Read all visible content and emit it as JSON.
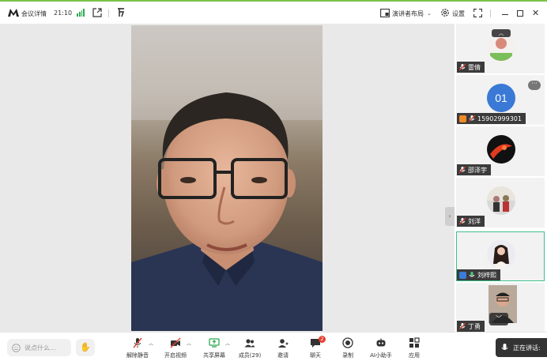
{
  "topbar": {
    "title": "会议详情",
    "time": "21:10",
    "layout_label": "演讲者布局",
    "settings_label": "设置"
  },
  "participants": [
    {
      "name": "雷倩",
      "avatar": "photo"
    },
    {
      "name": "15902999301",
      "avatar_text": "01",
      "host": true
    },
    {
      "name": "邵泽宇",
      "avatar": "photo"
    },
    {
      "name": "刘洋",
      "avatar": "photo"
    },
    {
      "name": "刘梓熙",
      "avatar": "photo",
      "active": true,
      "badge": "blue"
    },
    {
      "name": "丁勇",
      "avatar": "photo"
    }
  ],
  "toolbar": {
    "say_placeholder": "说点什么...",
    "unmute": "解除静音",
    "start_video": "开启视频",
    "share_screen": "共享屏幕",
    "members": "成员(29)",
    "invite": "邀请",
    "chat": "聊天",
    "chat_badge": "2",
    "record": "录制",
    "ai_assistant": "AI小助手",
    "apps": "应用",
    "speaking": "正在讲话:"
  },
  "colors": {
    "accent_green": "#7ac24a",
    "active_border": "#3cc08a",
    "avatar_blue": "#3a79d6",
    "host_badge": "#f08a24",
    "badge_red": "#e5402f"
  }
}
